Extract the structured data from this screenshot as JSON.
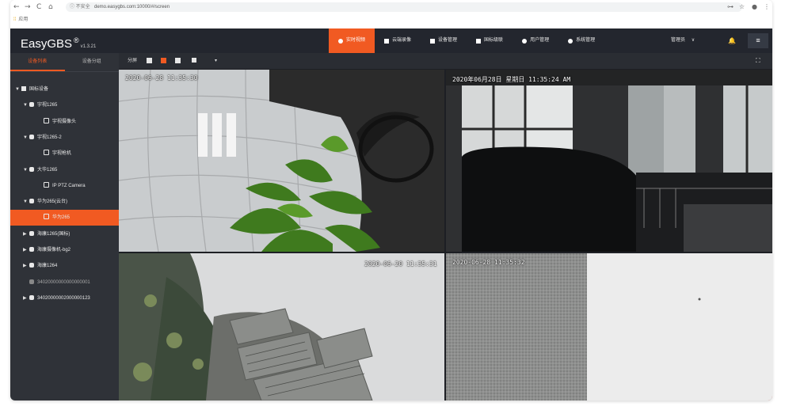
{
  "browser": {
    "nav_back": "←",
    "nav_forward": "→",
    "nav_reload": "C",
    "nav_home": "⌂",
    "security": "ⓘ 不安全",
    "url": "demo.easygbs.com:10000/#/screen",
    "bookmarks_label": "应用",
    "right_icons": [
      "⊶",
      "☆",
      "●",
      "⋮"
    ]
  },
  "app": {
    "brand": "EasyGBS",
    "brand_reg": "®",
    "version": "v1.3.21",
    "nav": [
      {
        "label": "实时视频",
        "active": true,
        "icon": "play-circle-icon"
      },
      {
        "label": "云端录像",
        "active": false,
        "icon": "video-icon"
      },
      {
        "label": "设备管理",
        "active": false,
        "icon": "device-icon"
      },
      {
        "label": "国标级联",
        "active": false,
        "icon": "cascade-icon"
      },
      {
        "label": "用户管理",
        "active": false,
        "icon": "user-icon"
      },
      {
        "label": "系统管理",
        "active": false,
        "icon": "gear-icon"
      }
    ],
    "user_label": "管理员",
    "user_caret": "∨",
    "bell": "🔔",
    "menu": "≡"
  },
  "sidebar": {
    "tabs": [
      {
        "label": "设备列表",
        "active": true
      },
      {
        "label": "设备分组",
        "active": false
      }
    ],
    "tree": [
      {
        "label": "国标设备",
        "level": 0,
        "arrow": "▼",
        "icon": "list-icon",
        "selected": false
      },
      {
        "label": "宇视1265",
        "level": 1,
        "arrow": "▼",
        "icon": "device-icon",
        "selected": false
      },
      {
        "label": "宇视摄像头",
        "level": 2,
        "arrow": "",
        "icon": "camera-icon",
        "selected": false
      },
      {
        "label": "宇视1265-2",
        "level": 1,
        "arrow": "▼",
        "icon": "device-icon",
        "selected": false
      },
      {
        "label": "宇视枪机",
        "level": 2,
        "arrow": "",
        "icon": "camera-icon",
        "selected": false
      },
      {
        "label": "大华1265",
        "level": 1,
        "arrow": "▼",
        "icon": "device-icon",
        "selected": false
      },
      {
        "label": "IP PTZ Camera",
        "level": 2,
        "arrow": "",
        "icon": "camera-icon",
        "selected": false
      },
      {
        "label": "华为265(云台)",
        "level": 1,
        "arrow": "▼",
        "icon": "device-icon",
        "selected": false
      },
      {
        "label": "华为265",
        "level": 2,
        "arrow": "",
        "icon": "camera-icon",
        "selected": true
      },
      {
        "label": "海康1265(国标)",
        "level": 1,
        "arrow": "▶",
        "icon": "device-icon",
        "selected": false
      },
      {
        "label": "海康摄像机-bg2",
        "level": 1,
        "arrow": "▶",
        "icon": "device-icon",
        "selected": false
      },
      {
        "label": "海康1264",
        "level": 1,
        "arrow": "▶",
        "icon": "device-icon",
        "selected": false
      },
      {
        "label": "34020000000000000001",
        "level": 1,
        "arrow": "",
        "icon": "device-icon-dim",
        "selected": false
      },
      {
        "label": "34020000002000000123",
        "level": 1,
        "arrow": "▶",
        "icon": "device-icon",
        "selected": false
      }
    ]
  },
  "toolbar": {
    "split_label": "分屏",
    "caret": "▾",
    "fullscreen": "⛶"
  },
  "videos": [
    {
      "timestamp": "2020-06-28 11:35:30"
    },
    {
      "timestamp": "2020年06月28日 星期日 11:35:24 AM"
    },
    {
      "timestamp": "2020-06-20 11:35:31"
    },
    {
      "timestamp": "2020-06-28 11:35:32"
    }
  ]
}
